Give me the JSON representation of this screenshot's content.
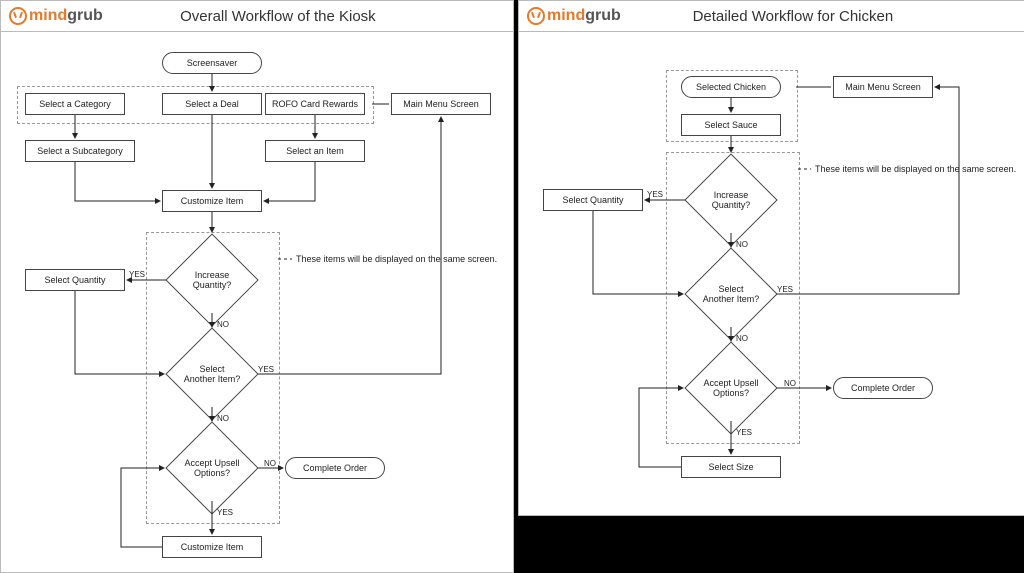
{
  "brand": {
    "name_part1": "mind",
    "name_part2": "grub"
  },
  "left": {
    "title": "Overall Workflow of the Kiosk",
    "screensaver": "Screensaver",
    "main_menu": "Main Menu Screen",
    "select_category": "Select a Category",
    "select_deal": "Select a Deal",
    "rofo": "ROFO Card Rewards",
    "select_subcategory": "Select a Subcategory",
    "select_item": "Select an Item",
    "customize_item": "Customize Item",
    "increase_q": "Increase Quantity?",
    "select_quantity": "Select Quantity",
    "select_another": "Select Another Item?",
    "accept_upsell": "Accept Upsell Options?",
    "complete": "Complete Order",
    "customize_item2": "Customize Item",
    "note": "These items will be displayed on the same screen.",
    "yes": "YES",
    "no": "NO"
  },
  "right": {
    "title": "Detailed Workflow for Chicken",
    "selected_chicken": "Selected Chicken",
    "main_menu": "Main Menu Screen",
    "select_sauce": "Select Sauce",
    "increase_q": "Increase Quantity?",
    "select_quantity": "Select Quantity",
    "select_another": "Select Another Item?",
    "accept_upsell": "Accept Upsell Options?",
    "complete": "Complete Order",
    "select_size": "Select Size",
    "note": "These items will be displayed on the same screen.",
    "yes": "YES",
    "no": "NO"
  }
}
